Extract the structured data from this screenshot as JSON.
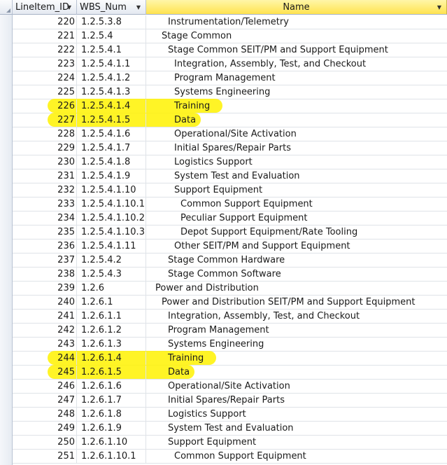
{
  "columns": {
    "id": "LineItem_ID",
    "wbs": "WBS_Num",
    "name": "Name"
  },
  "accent": {
    "highlight": "#fff200",
    "selected_header": "#ffe34f"
  },
  "rows": [
    {
      "id": "220",
      "wbs": "1.2.5.3.8",
      "name": "Instrumentation/Telemetry",
      "level": 3,
      "hl": false
    },
    {
      "id": "221",
      "wbs": "1.2.5.4",
      "name": "Stage Common",
      "level": 2,
      "hl": false
    },
    {
      "id": "222",
      "wbs": "1.2.5.4.1",
      "name": "Stage Common SEIT/PM and Support Equipment",
      "level": 3,
      "hl": false
    },
    {
      "id": "223",
      "wbs": "1.2.5.4.1.1",
      "name": "Integration, Assembly, Test, and Checkout",
      "level": 4,
      "hl": false
    },
    {
      "id": "224",
      "wbs": "1.2.5.4.1.2",
      "name": "Program Management",
      "level": 4,
      "hl": false
    },
    {
      "id": "225",
      "wbs": "1.2.5.4.1.3",
      "name": "Systems Engineering",
      "level": 4,
      "hl": false
    },
    {
      "id": "226",
      "wbs": "1.2.5.4.1.4",
      "name": "Training",
      "level": 4,
      "hl": true
    },
    {
      "id": "227",
      "wbs": "1.2.5.4.1.5",
      "name": "Data",
      "level": 4,
      "hl": true
    },
    {
      "id": "228",
      "wbs": "1.2.5.4.1.6",
      "name": "Operational/Site Activation",
      "level": 4,
      "hl": false
    },
    {
      "id": "229",
      "wbs": "1.2.5.4.1.7",
      "name": "Initial Spares/Repair Parts",
      "level": 4,
      "hl": false
    },
    {
      "id": "230",
      "wbs": "1.2.5.4.1.8",
      "name": "Logistics Support",
      "level": 4,
      "hl": false
    },
    {
      "id": "231",
      "wbs": "1.2.5.4.1.9",
      "name": "System Test and Evaluation",
      "level": 4,
      "hl": false
    },
    {
      "id": "232",
      "wbs": "1.2.5.4.1.10",
      "name": "Support Equipment",
      "level": 4,
      "hl": false
    },
    {
      "id": "233",
      "wbs": "1.2.5.4.1.10.1",
      "name": "Common Support Equipment",
      "level": 5,
      "hl": false
    },
    {
      "id": "234",
      "wbs": "1.2.5.4.1.10.2",
      "name": "Peculiar Support Equipment",
      "level": 5,
      "hl": false
    },
    {
      "id": "235",
      "wbs": "1.2.5.4.1.10.3",
      "name": "Depot Support Equipment/Rate Tooling",
      "level": 5,
      "hl": false
    },
    {
      "id": "236",
      "wbs": "1.2.5.4.1.11",
      "name": "Other SEIT/PM and Support Equipment",
      "level": 4,
      "hl": false
    },
    {
      "id": "237",
      "wbs": "1.2.5.4.2",
      "name": "Stage Common Hardware",
      "level": 3,
      "hl": false
    },
    {
      "id": "238",
      "wbs": "1.2.5.4.3",
      "name": "Stage Common Software",
      "level": 3,
      "hl": false
    },
    {
      "id": "239",
      "wbs": "1.2.6",
      "name": "Power and Distribution",
      "level": 1,
      "hl": false
    },
    {
      "id": "240",
      "wbs": "1.2.6.1",
      "name": "Power and Distribution SEIT/PM and Support Equipment",
      "level": 2,
      "hl": false
    },
    {
      "id": "241",
      "wbs": "1.2.6.1.1",
      "name": "Integration, Assembly, Test, and Checkout",
      "level": 3,
      "hl": false
    },
    {
      "id": "242",
      "wbs": "1.2.6.1.2",
      "name": "Program Management",
      "level": 3,
      "hl": false
    },
    {
      "id": "243",
      "wbs": "1.2.6.1.3",
      "name": "Systems Engineering",
      "level": 3,
      "hl": false
    },
    {
      "id": "244",
      "wbs": "1.2.6.1.4",
      "name": "Training",
      "level": 3,
      "hl": true
    },
    {
      "id": "245",
      "wbs": "1.2.6.1.5",
      "name": "Data",
      "level": 3,
      "hl": true
    },
    {
      "id": "246",
      "wbs": "1.2.6.1.6",
      "name": "Operational/Site Activation",
      "level": 3,
      "hl": false
    },
    {
      "id": "247",
      "wbs": "1.2.6.1.7",
      "name": "Initial Spares/Repair Parts",
      "level": 3,
      "hl": false
    },
    {
      "id": "248",
      "wbs": "1.2.6.1.8",
      "name": "Logistics Support",
      "level": 3,
      "hl": false
    },
    {
      "id": "249",
      "wbs": "1.2.6.1.9",
      "name": "System Test and Evaluation",
      "level": 3,
      "hl": false
    },
    {
      "id": "250",
      "wbs": "1.2.6.1.10",
      "name": "Support Equipment",
      "level": 3,
      "hl": false
    },
    {
      "id": "251",
      "wbs": "1.2.6.1.10.1",
      "name": "Common Support Equipment",
      "level": 4,
      "hl": false
    }
  ]
}
